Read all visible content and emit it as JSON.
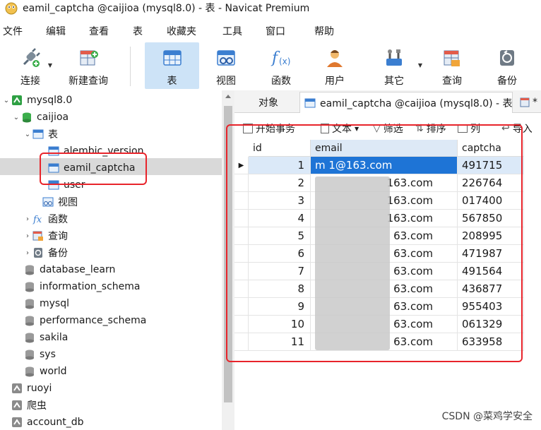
{
  "window": {
    "title": "eamil_captcha @caijioa (mysql8.0) - 表 - Navicat Premium"
  },
  "menu": [
    "文件",
    "编辑",
    "查看",
    "表",
    "收藏夹",
    "工具",
    "窗口",
    "帮助"
  ],
  "toolbar": [
    {
      "label": "连接",
      "icon": "plug-icon"
    },
    {
      "label": "新建查询",
      "icon": "new-query-icon"
    },
    {
      "label": "表",
      "icon": "table-icon",
      "active": true
    },
    {
      "label": "视图",
      "icon": "view-icon"
    },
    {
      "label": "函数",
      "icon": "function-icon"
    },
    {
      "label": "用户",
      "icon": "user-icon"
    },
    {
      "label": "其它",
      "icon": "tools-icon"
    },
    {
      "label": "查询",
      "icon": "query-icon"
    },
    {
      "label": "备份",
      "icon": "backup-icon"
    }
  ],
  "tree": {
    "connection": "mysql8.0",
    "database": "caijioa",
    "tables_group": "表",
    "tables": [
      "alembic_version",
      "eamil_captcha",
      "user"
    ],
    "views": "视图",
    "functions": "函数",
    "queries": "查询",
    "backups": "备份",
    "other_dbs": [
      "database_learn",
      "information_schema",
      "mysql",
      "performance_schema",
      "sakila",
      "sys",
      "world"
    ],
    "other_connections": [
      "ruoyi",
      "爬虫",
      "account_db"
    ]
  },
  "tabs": {
    "objects": "对象",
    "active": "eamil_captcha @caijioa (mysql8.0) - 表",
    "more": "*"
  },
  "grid_toolbar": {
    "begin_tx": "开始事务",
    "text": "文本",
    "filter": "筛选",
    "sort": "排序",
    "columns": "列",
    "import": "导入"
  },
  "grid": {
    "columns": [
      "id",
      "email",
      "captcha"
    ],
    "rows": [
      {
        "id": "1",
        "email": "m        1@163.com",
        "captcha": "491715"
      },
      {
        "id": "2",
        "email": "163.com",
        "captcha": "226764"
      },
      {
        "id": "3",
        "email": "163.com",
        "captcha": "017400"
      },
      {
        "id": "4",
        "email": "163.com",
        "captcha": "567850"
      },
      {
        "id": "5",
        "email": "63.com",
        "captcha": "208995"
      },
      {
        "id": "6",
        "email": "63.com",
        "captcha": "471987"
      },
      {
        "id": "7",
        "email": "63.com",
        "captcha": "491564"
      },
      {
        "id": "8",
        "email": "63.com",
        "captcha": "436877"
      },
      {
        "id": "9",
        "email": "63.com",
        "captcha": "955403"
      },
      {
        "id": "10",
        "email": "63.com",
        "captcha": "061329"
      },
      {
        "id": "11",
        "email": "63.com",
        "captcha": "633958"
      }
    ]
  },
  "watermark": "CSDN @菜鸡学安全"
}
